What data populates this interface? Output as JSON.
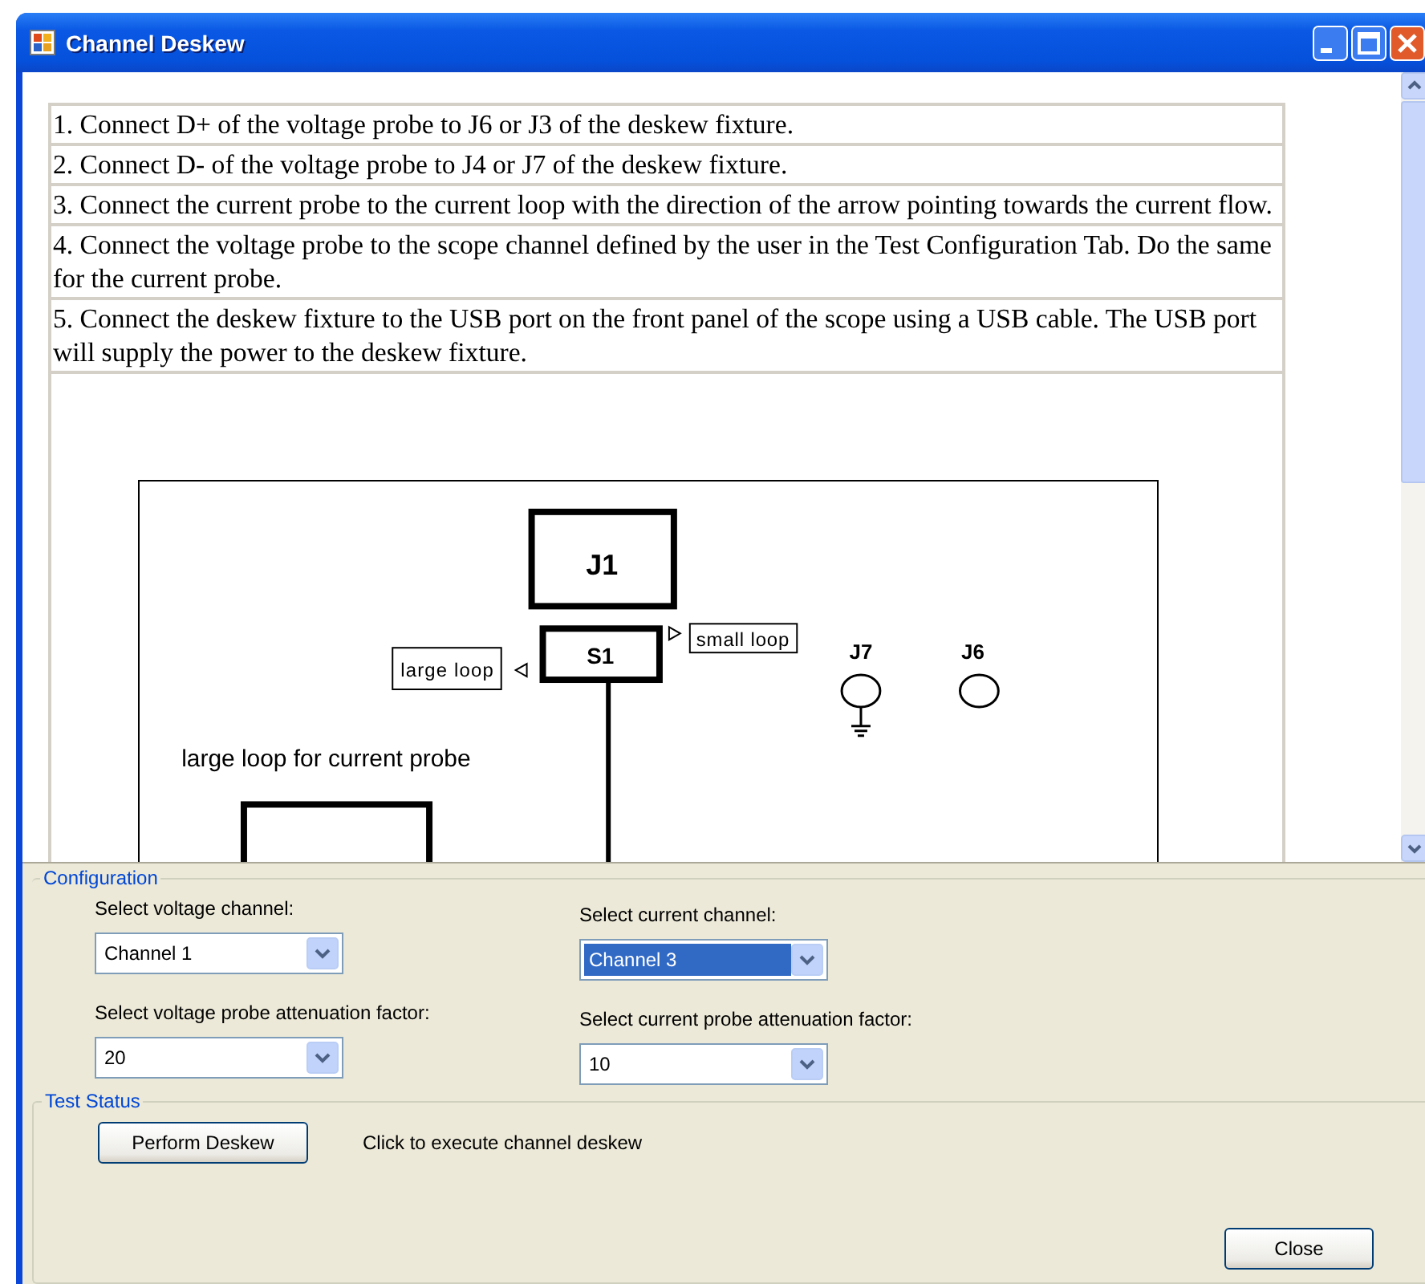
{
  "window": {
    "title": "Channel Deskew"
  },
  "instructions": [
    "1. Connect D+ of the voltage probe to J6 or J3 of the deskew fixture.",
    "2. Connect D- of the voltage probe to J4 or J7 of the deskew fixture.",
    "3. Connect the current probe to the current loop with the direction of the arrow pointing towards the current flow.",
    "4. Connect the voltage probe to the scope channel defined by the user in the Test Configuration Tab. Do the same for the current probe.",
    "5. Connect the deskew fixture to the USB port on the front panel of the scope using a USB cable. The USB port will supply the power to the deskew fixture."
  ],
  "diagram": {
    "j1": "J1",
    "s1": "S1",
    "large_loop": "large loop",
    "small_loop": "small loop",
    "j7": "J7",
    "j6": "J6",
    "caption": "large loop for current probe"
  },
  "configuration": {
    "title": "Configuration",
    "fields": [
      {
        "label": "Select voltage channel:",
        "value": "Channel 1",
        "focused": false
      },
      {
        "label": "Select current channel:",
        "value": "Channel 3",
        "focused": true
      },
      {
        "label": "Select voltage probe attenuation factor:",
        "value": "20",
        "focused": false
      },
      {
        "label": "Select current probe attenuation factor:",
        "value": "10",
        "focused": false
      }
    ]
  },
  "test_status": {
    "title": "Test Status",
    "button": "Perform Deskew",
    "message": "Click to execute channel deskew"
  },
  "close_button": "Close"
}
